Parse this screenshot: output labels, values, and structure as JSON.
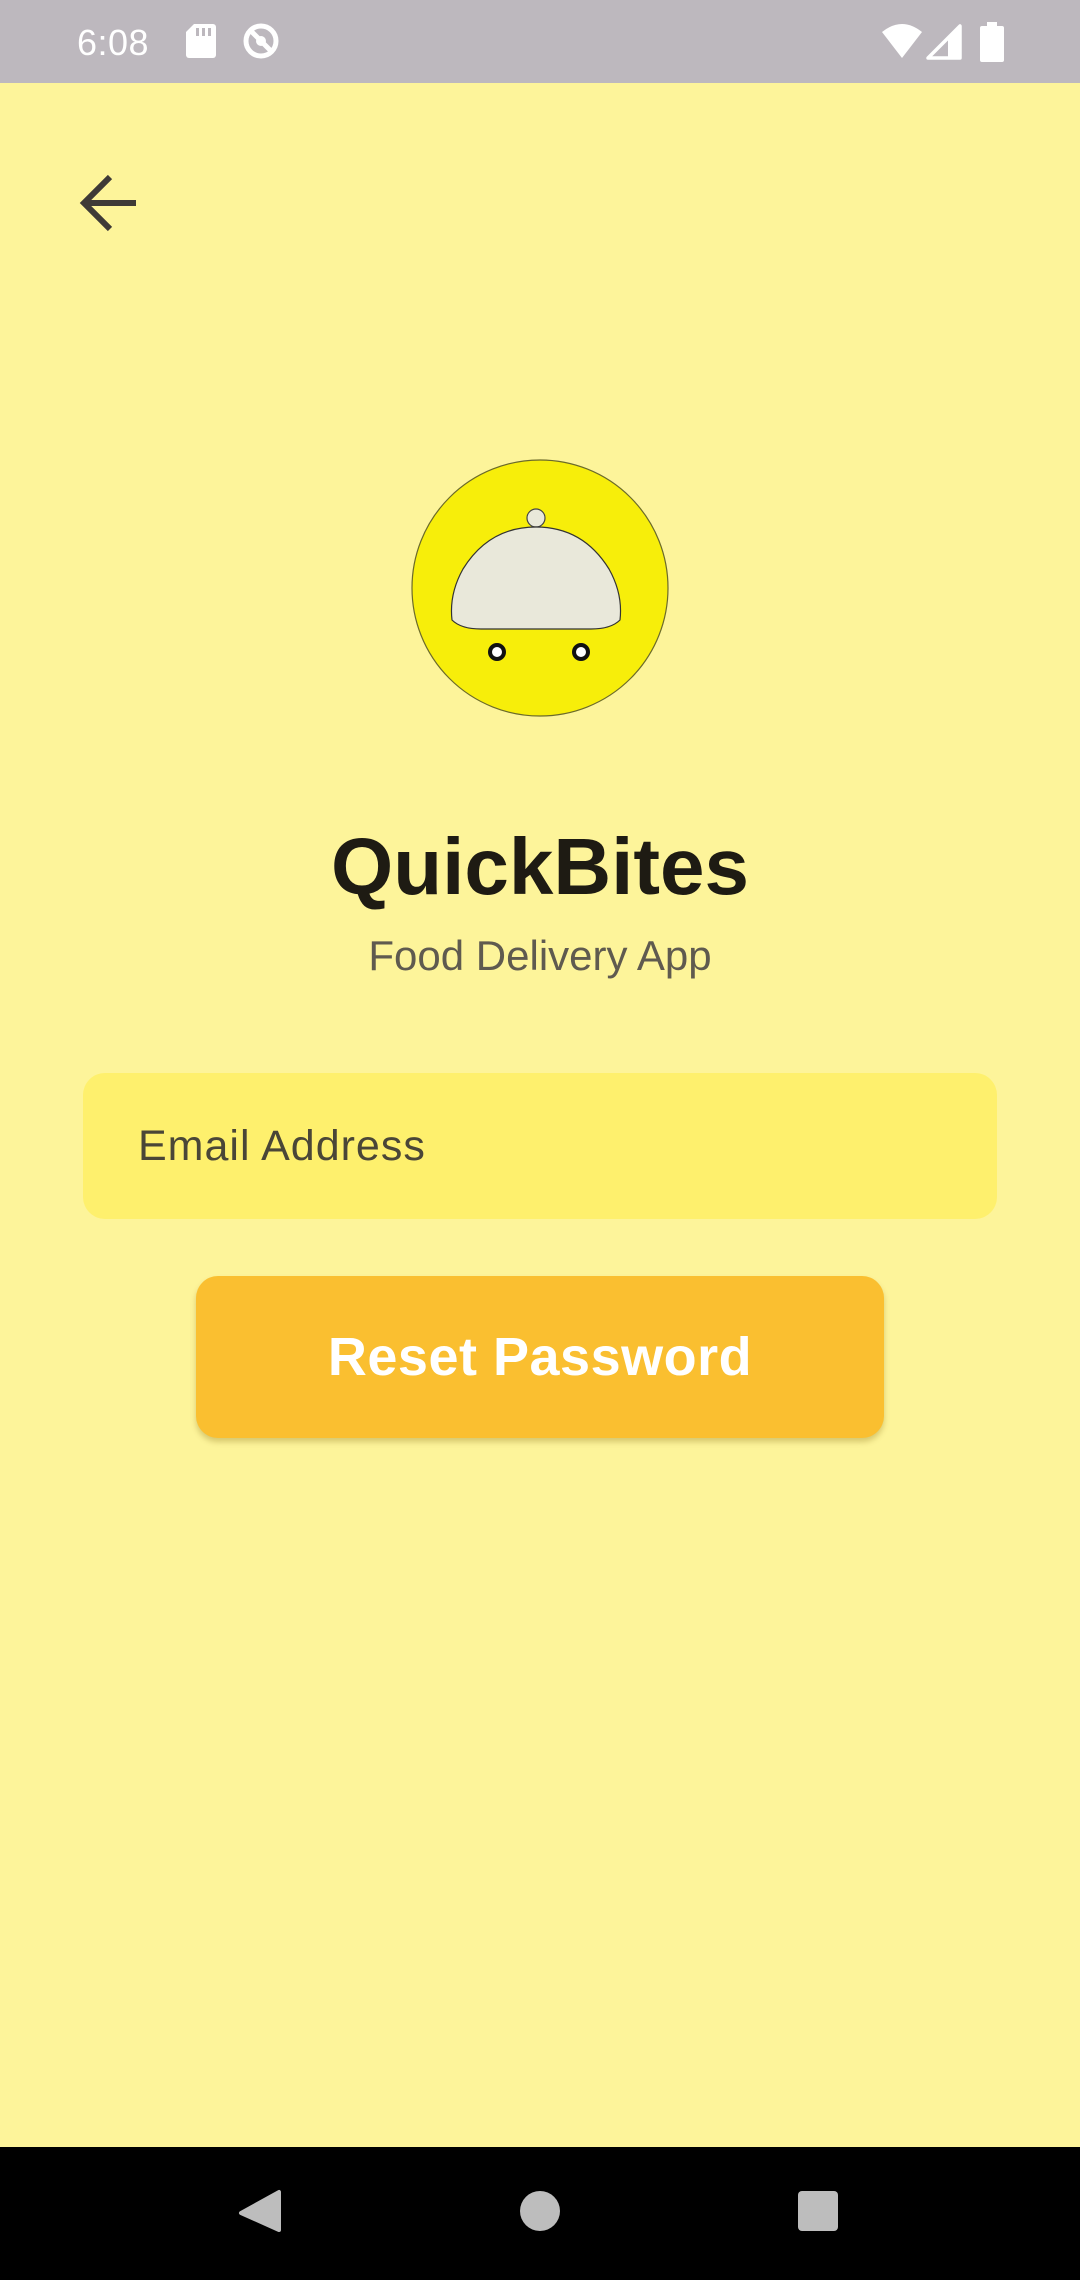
{
  "status_bar": {
    "time": "6:08",
    "icons": [
      "sd-card-icon",
      "data-saver-icon",
      "wifi-icon",
      "cell-signal-icon",
      "battery-icon"
    ]
  },
  "header": {
    "back_icon": "arrow-back-icon"
  },
  "brand": {
    "logo_icon": "food-cloche-cart-icon",
    "name": "QuickBites",
    "subtitle": "Food Delivery App"
  },
  "form": {
    "email": {
      "placeholder": "Email Address",
      "value": ""
    },
    "reset_button_label": "Reset Password"
  },
  "nav_bar": {
    "icons": [
      "back-triangle-icon",
      "home-circle-icon",
      "recents-square-icon"
    ]
  },
  "colors": {
    "background": "#FDF49A",
    "status_bar": "#BDB8BE",
    "input_fill": "#FEF06D",
    "button": "#FABF30",
    "logo_circle": "#F7EE0A",
    "cloche": "#E9E8DA",
    "title": "#1E1B13",
    "subtitle": "#5F5A4F"
  }
}
